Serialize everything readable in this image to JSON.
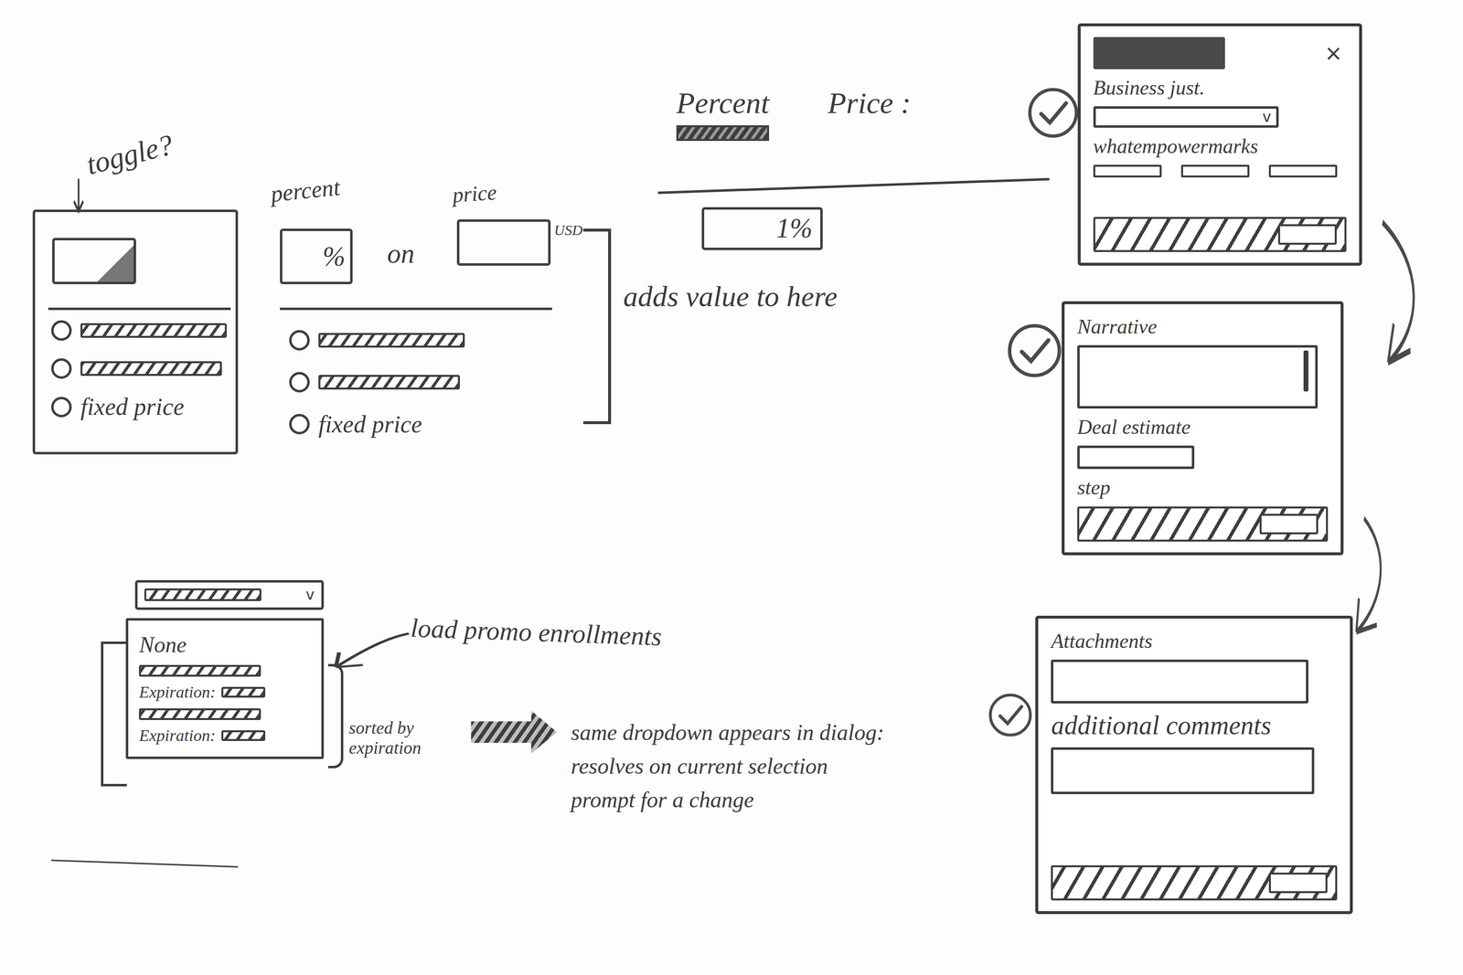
{
  "toggle_sketch": {
    "title": "toggle?",
    "options": [
      {
        "kind": "bar",
        "selected": false
      },
      {
        "kind": "bar",
        "selected": false
      },
      {
        "kind": "text",
        "label": "fixed price",
        "selected": false
      }
    ]
  },
  "discount_sketch": {
    "percent_label": "percent",
    "percent_field": "%",
    "connector": "on",
    "price_label": "price",
    "currency": "USD",
    "options": [
      {
        "kind": "bar",
        "selected": false
      },
      {
        "kind": "bar",
        "selected": false
      },
      {
        "kind": "text",
        "label": "fixed price",
        "selected": false
      }
    ],
    "note": "adds value to here"
  },
  "mode_sketch": {
    "tabs": [
      {
        "label": "Percent",
        "selected": true
      },
      {
        "label": "Price :",
        "selected": false
      }
    ],
    "value": "1%"
  },
  "wizard": [
    {
      "done": true,
      "fields": [
        {
          "kind": "titlebar",
          "close": "×"
        },
        {
          "kind": "label",
          "text": "Business just."
        },
        {
          "kind": "select",
          "chevron": "v"
        },
        {
          "kind": "label",
          "text": "whatempowermarks"
        },
        {
          "kind": "chips"
        },
        {
          "kind": "footer"
        }
      ]
    },
    {
      "done": true,
      "fields": [
        {
          "kind": "label",
          "text": "Narrative"
        },
        {
          "kind": "textarea"
        },
        {
          "kind": "label",
          "text": "Deal estimate"
        },
        {
          "kind": "input"
        },
        {
          "kind": "label",
          "text": "step"
        },
        {
          "kind": "footer"
        }
      ]
    },
    {
      "done": true,
      "fields": [
        {
          "kind": "label",
          "text": "Attachments"
        },
        {
          "kind": "input"
        },
        {
          "kind": "label",
          "text": "additional comments"
        },
        {
          "kind": "textarea"
        },
        {
          "kind": "footer"
        }
      ]
    }
  ],
  "promo_dropdown": {
    "chevron": "v",
    "items": [
      {
        "kind": "none",
        "label": "None"
      },
      {
        "kind": "promo",
        "expiry_label": "Expiration:"
      },
      {
        "kind": "promo",
        "expiry_label": "Expiration:"
      }
    ],
    "side_note": "sorted by expiration",
    "callout": "load promo enrollments",
    "notes": [
      "same dropdown appears in dialog:",
      "resolves on current selection",
      "prompt for a change"
    ]
  }
}
